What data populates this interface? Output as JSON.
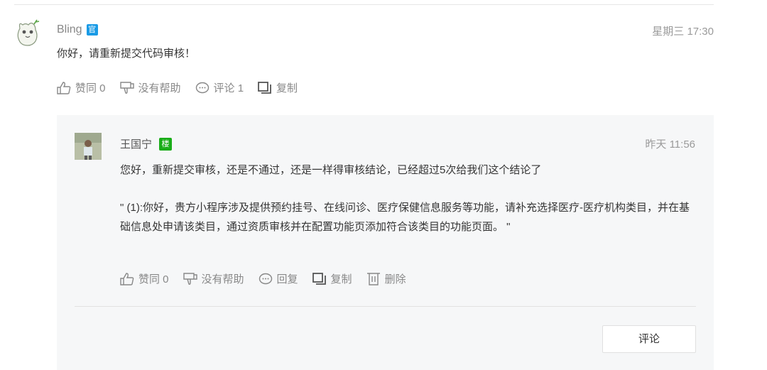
{
  "main_comment": {
    "author": "Bling",
    "badge": "官",
    "time": "星期三 17:30",
    "content": "你好，请重新提交代码审核！",
    "actions": {
      "agree": "赞同 0",
      "not_helpful": "没有帮助",
      "comment": "评论 1",
      "copy": "复制"
    }
  },
  "reply": {
    "author": "王国宁",
    "floor_badge": "楼",
    "time": "昨天 11:56",
    "line1": "您好，重新提交审核，还是不通过，还是一样得审核结论，已经超过5次给我们这个结论了",
    "line2": "\" (1):你好，贵方小程序涉及提供预约挂号、在线问诊、医疗保健信息服务等功能，请补充选择医疗-医疗机构类目，并在基础信息处申请该类目，通过资质审核并在配置功能页添加符合该类目的功能页面。 \"",
    "actions": {
      "agree": "赞同 0",
      "not_helpful": "没有帮助",
      "reply": "回复",
      "copy": "复制",
      "delete": "删除"
    }
  },
  "comment_button": "评论",
  "colors": {
    "official_badge": "#1a9be6",
    "floor_badge": "#1aad19",
    "reply_bg": "#f6f7f8"
  }
}
